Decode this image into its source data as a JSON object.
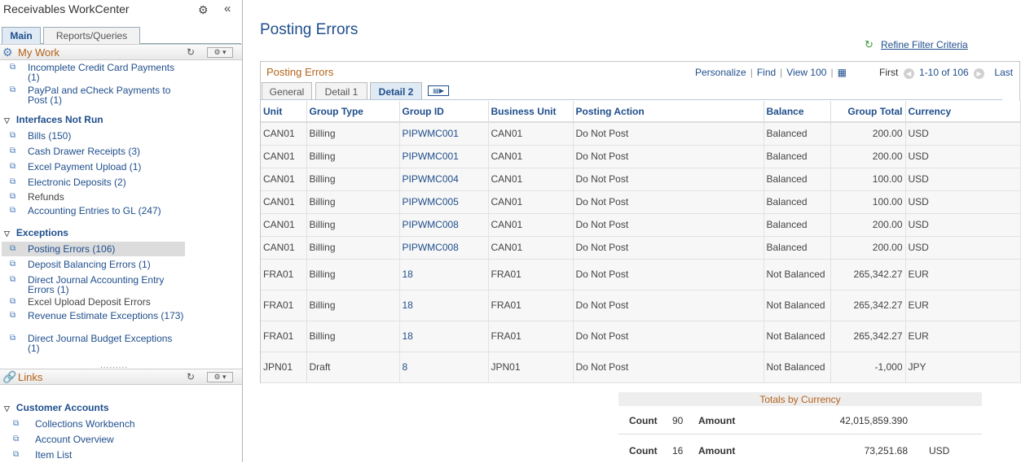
{
  "workcenter": {
    "title": "Receivables WorkCenter",
    "tabs": [
      {
        "label": "Main"
      },
      {
        "label": "Reports/Queries"
      }
    ]
  },
  "my_work": {
    "title": "My Work",
    "items_top": [
      {
        "label": "Incomplete Credit Card Payments (1)"
      },
      {
        "label": "PayPal and eCheck Payments to Post (1)"
      }
    ],
    "interfaces": {
      "title": "Interfaces Not Run",
      "items": [
        {
          "label": "Bills (150)"
        },
        {
          "label": "Cash Drawer Receipts (3)"
        },
        {
          "label": "Excel Payment Upload (1)"
        },
        {
          "label": "Electronic Deposits (2)"
        },
        {
          "label": "Refunds"
        },
        {
          "label": "Accounting Entries to GL (247)"
        }
      ]
    },
    "exceptions": {
      "title": "Exceptions",
      "items": [
        {
          "label": "Posting Errors (106)"
        },
        {
          "label": "Deposit Balancing Errors (1)"
        },
        {
          "label": "Direct Journal Accounting Entry Errors (1)"
        },
        {
          "label": "Excel Upload Deposit Errors"
        },
        {
          "label": "Revenue Estimate Exceptions (173)"
        },
        {
          "label": "Direct Journal Budget Exceptions (1)"
        }
      ]
    }
  },
  "links": {
    "title": "Links",
    "group": "Customer Accounts",
    "items": [
      {
        "label": "Collections Workbench"
      },
      {
        "label": "Account Overview"
      },
      {
        "label": "Item List"
      }
    ]
  },
  "main": {
    "page_title": "Posting Errors",
    "refine_label": "Refine Filter Criteria"
  },
  "grid": {
    "title": "Posting Errors",
    "tools": {
      "personalize": "Personalize",
      "find": "Find",
      "view": "View 100"
    },
    "nav": {
      "first": "First",
      "range": "1-10 of 106",
      "last": "Last"
    },
    "tabs": [
      {
        "label": "General"
      },
      {
        "label": "Detail 1"
      },
      {
        "label": "Detail 2"
      }
    ],
    "columns": [
      "Unit",
      "Group Type",
      "Group ID",
      "Business Unit",
      "Posting Action",
      "Balance",
      "Group Total",
      "Currency"
    ],
    "rows": [
      {
        "unit": "CAN01",
        "type": "Billing",
        "gid": "PIPWMC001",
        "bu": "CAN01",
        "action": "Do Not Post",
        "balance": "Balanced",
        "total": "200.00",
        "cur": "USD"
      },
      {
        "unit": "CAN01",
        "type": "Billing",
        "gid": "PIPWMC001",
        "bu": "CAN01",
        "action": "Do Not Post",
        "balance": "Balanced",
        "total": "200.00",
        "cur": "USD"
      },
      {
        "unit": "CAN01",
        "type": "Billing",
        "gid": "PIPWMC004",
        "bu": "CAN01",
        "action": "Do Not Post",
        "balance": "Balanced",
        "total": "100.00",
        "cur": "USD"
      },
      {
        "unit": "CAN01",
        "type": "Billing",
        "gid": "PIPWMC005",
        "bu": "CAN01",
        "action": "Do Not Post",
        "balance": "Balanced",
        "total": "100.00",
        "cur": "USD"
      },
      {
        "unit": "CAN01",
        "type": "Billing",
        "gid": "PIPWMC008",
        "bu": "CAN01",
        "action": "Do Not Post",
        "balance": "Balanced",
        "total": "200.00",
        "cur": "USD"
      },
      {
        "unit": "CAN01",
        "type": "Billing",
        "gid": "PIPWMC008",
        "bu": "CAN01",
        "action": "Do Not Post",
        "balance": "Balanced",
        "total": "200.00",
        "cur": "USD"
      },
      {
        "unit": "FRA01",
        "type": "Billing",
        "gid": "18",
        "bu": "FRA01",
        "action": "Do Not Post",
        "balance": "Not Balanced",
        "total": "265,342.27",
        "cur": "EUR"
      },
      {
        "unit": "FRA01",
        "type": "Billing",
        "gid": "18",
        "bu": "FRA01",
        "action": "Do Not Post",
        "balance": "Not Balanced",
        "total": "265,342.27",
        "cur": "EUR"
      },
      {
        "unit": "FRA01",
        "type": "Billing",
        "gid": "18",
        "bu": "FRA01",
        "action": "Do Not Post",
        "balance": "Not Balanced",
        "total": "265,342.27",
        "cur": "EUR"
      },
      {
        "unit": "JPN01",
        "type": "Draft",
        "gid": "8",
        "bu": "JPN01",
        "action": "Do Not Post",
        "balance": "Not Balanced",
        "total": "-1,000",
        "cur": "JPY"
      }
    ]
  },
  "totals": {
    "title": "Totals by Currency",
    "rows": [
      {
        "count_label": "Count",
        "count": "90",
        "amount_label": "Amount",
        "amount": "42,015,859.390",
        "currency": ""
      },
      {
        "count_label": "Count",
        "count": "16",
        "amount_label": "Amount",
        "amount": "73,251.68",
        "currency": "USD"
      }
    ]
  }
}
